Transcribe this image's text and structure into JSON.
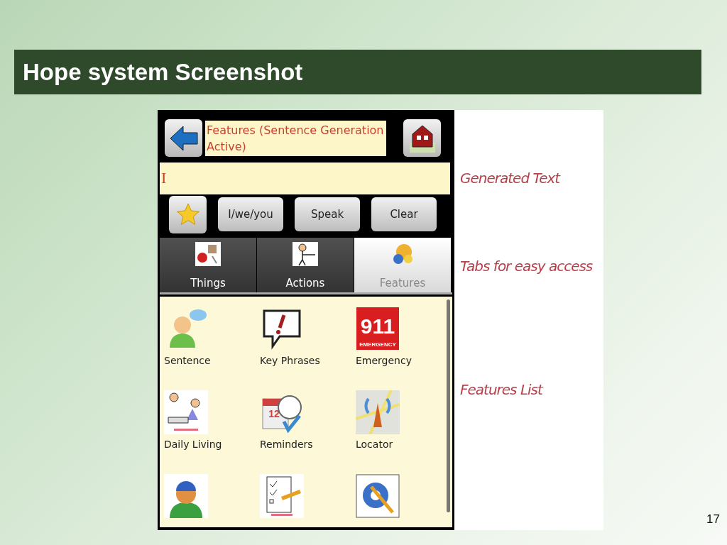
{
  "slide": {
    "title": "Hope system Screenshot",
    "page_number": "17"
  },
  "app": {
    "header": {
      "title": "Features (Sentence Generation Active)"
    },
    "generated_text": {
      "value": "I"
    },
    "actions": [
      {
        "kind": "favorite"
      },
      {
        "kind": "text",
        "label": "I/we/you"
      },
      {
        "kind": "text",
        "label": "Speak"
      },
      {
        "kind": "text",
        "label": "Clear"
      }
    ],
    "tabs": [
      {
        "label": "Things",
        "selected": false
      },
      {
        "label": "Actions",
        "selected": false
      },
      {
        "label": "Features",
        "selected": true
      }
    ],
    "features": [
      {
        "kind": "labeled",
        "label": "Sentence"
      },
      {
        "kind": "labeled",
        "label": "Key Phrases"
      },
      {
        "kind": "labeled",
        "label": "Emergency",
        "icon_text": [
          "911",
          "EMERGENCY"
        ]
      },
      {
        "kind": "labeled",
        "label": "Daily Living"
      },
      {
        "kind": "labeled",
        "label": "Reminders",
        "icon_text": [
          "12"
        ]
      },
      {
        "kind": "labeled",
        "label": "Locator"
      },
      {
        "kind": "icon_only"
      },
      {
        "kind": "icon_only"
      },
      {
        "kind": "icon_only"
      }
    ]
  },
  "annotations": [
    "Generated Text",
    "Tabs for easy access",
    "Features List"
  ]
}
